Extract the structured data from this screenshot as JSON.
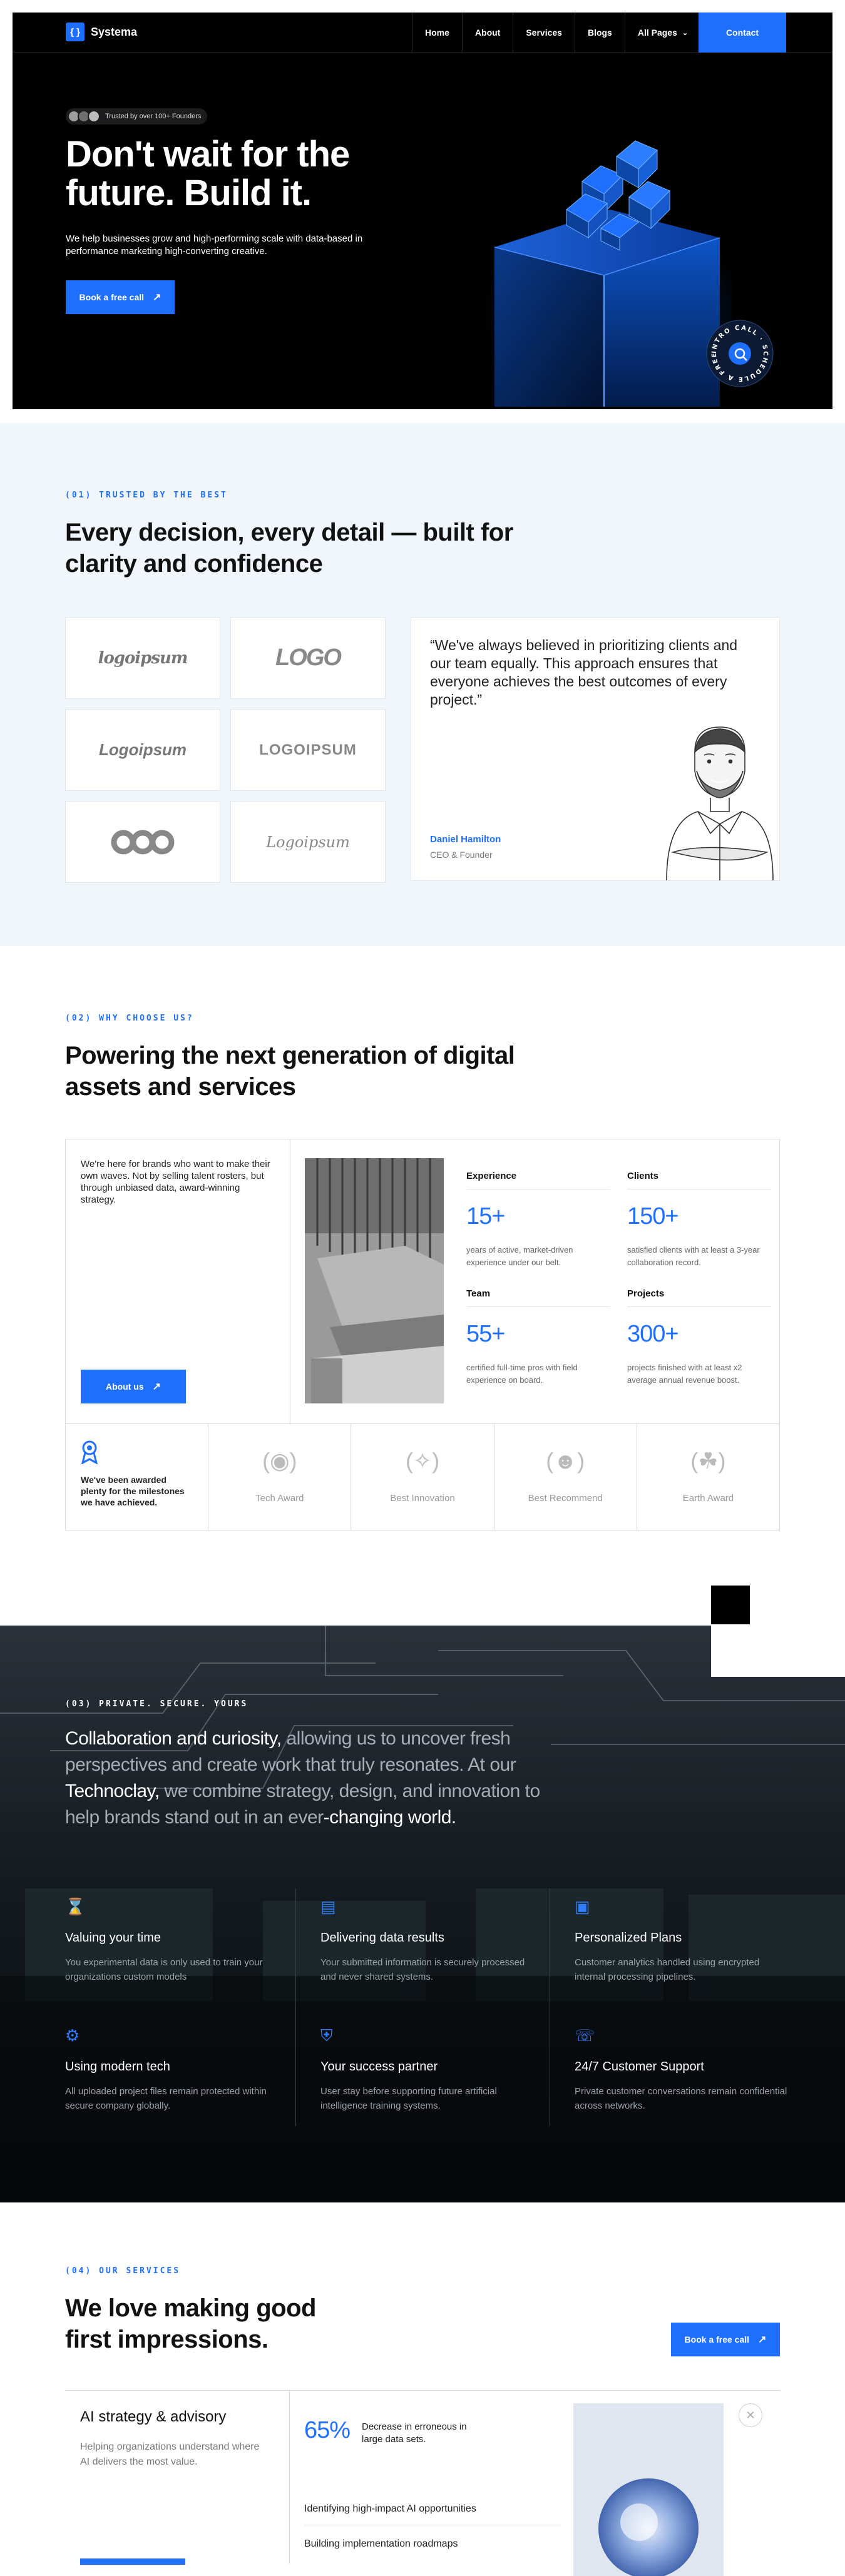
{
  "nav": {
    "brand": "Systema",
    "brand_icon": "braces-icon",
    "links": [
      "Home",
      "About",
      "Services",
      "Blogs",
      "All Pages"
    ],
    "contact": "Contact"
  },
  "hero": {
    "trusted": "Trusted by over 100+ Founders",
    "title": "Don't wait for the future. Build it.",
    "subtitle": "We help businesses grow and high-performing scale with data-based in performance marketing high-converting creative.",
    "cta": "Book a free call",
    "badge_text": "INTRO CALL · SCHEDULE A FREE ·"
  },
  "trusted_section": {
    "eyebrow": "(01) TRUSTED BY THE BEST",
    "title": "Every decision, every detail — built for clarity and confidence",
    "logos": [
      "logoipsum",
      "LOGO",
      "Logoipsum",
      "LOGOIPSUM",
      "infinity-logo",
      "Logoipsum"
    ],
    "quote": "“We've always believed in prioritizing clients and our team equally. This approach ensures that everyone achieves the best outcomes of every project.”",
    "author": "Daniel Hamilton",
    "role": "CEO & Founder"
  },
  "why": {
    "eyebrow": "(02) WHY CHOOSE US?",
    "title": "Powering the next generation of digital assets and services",
    "intro": "We're here for brands who want to make their own waves. Not by selling talent rosters, but through unbiased data, award-winning strategy.",
    "about_btn": "About us",
    "stats": [
      {
        "label": "Experience",
        "value": "15+",
        "desc": "years of active, market-driven experience under our belt."
      },
      {
        "label": "Clients",
        "value": "150+",
        "desc": "satisfied clients with at least a 3-year collaboration record."
      },
      {
        "label": "Team",
        "value": "55+",
        "desc": "certified full-time pros with field experience on board."
      },
      {
        "label": "Projects",
        "value": "300+",
        "desc": "projects finished with at least x2 average annual revenue boost."
      }
    ],
    "award_intro": "We've been awarded plenty for the milestones we have achieved.",
    "awards": [
      "Tech Award",
      "Best Innovation",
      "Best Recommend",
      "Earth Award"
    ]
  },
  "private": {
    "eyebrow": "(03) PRIVATE. SECURE. YOURS",
    "statement_bright_1": "Collaboration and curiosity,",
    "statement_dim_1": " allowing us to uncover fresh perspectives and create work that truly resonates. At our ",
    "statement_bright_2": "Technoclay,",
    "statement_dim_2": " we combine strategy, design, and innovation to help brands stand out in an ever",
    "statement_bright_3": "-changing world.",
    "features": [
      {
        "icon": "hourglass-icon",
        "title": "Valuing your time",
        "desc": "You experimental data is only used to train your organizations custom models"
      },
      {
        "icon": "chart-icon",
        "title": "Delivering data results",
        "desc": "Your submitted information is securely processed and never shared systems."
      },
      {
        "icon": "book-icon",
        "title": "Personalized Plans",
        "desc": "Customer analytics handled using encrypted internal processing pipelines."
      },
      {
        "icon": "gear-icon",
        "title": "Using modern tech",
        "desc": "All uploaded project files remain protected within secure company globally."
      },
      {
        "icon": "shield-icon",
        "title": "Your success partner",
        "desc": "User stay before supporting future artificial intelligence training systems."
      },
      {
        "icon": "headset-icon",
        "title": "24/7 Customer Support",
        "desc": "Private customer conversations remain confidential across networks."
      }
    ]
  },
  "services": {
    "eyebrow": "(04) OUR SERVICES",
    "title": "We love making good first impressions.",
    "cta": "Book a free call",
    "item_title": "AI strategy & advisory",
    "item_desc": "Helping organizations understand where AI delivers the most value.",
    "metric_value": "65%",
    "metric_desc": "Decrease in erroneous in large data sets.",
    "list": [
      "Identifying high-impact AI opportunities",
      "Building implementation roadmaps"
    ]
  },
  "colors": {
    "accent": "#1f6fff",
    "dark": "#000000",
    "light_bg": "#f1f6fc"
  }
}
